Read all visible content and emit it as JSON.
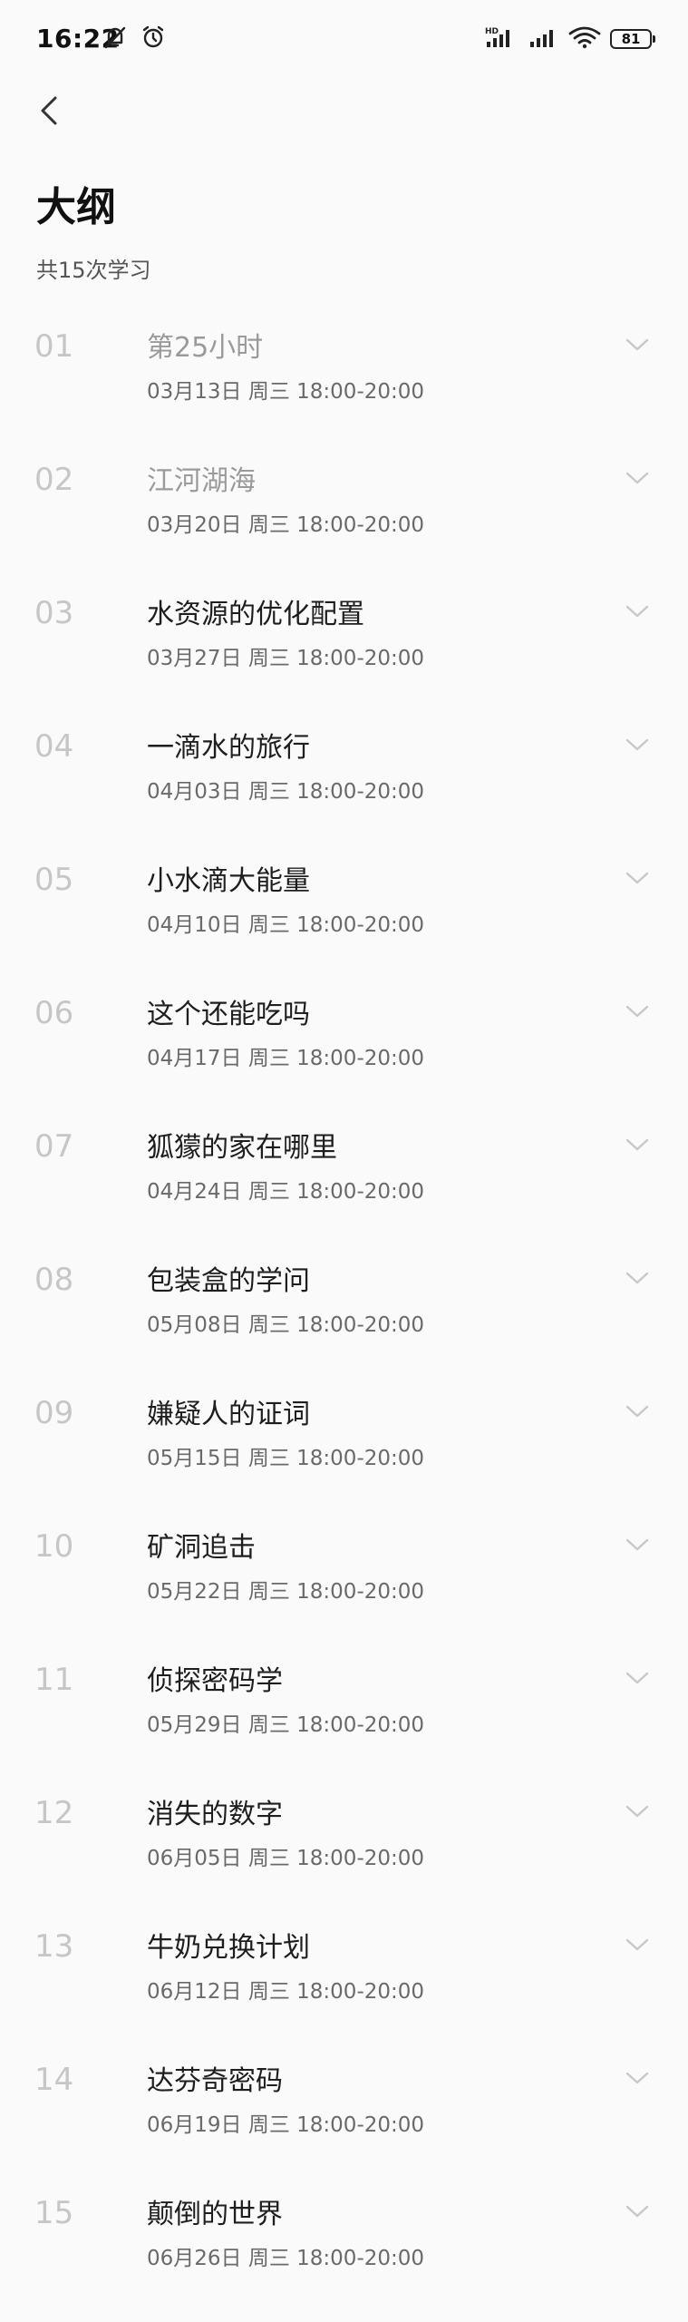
{
  "status_bar": {
    "time": "16:22",
    "battery": "81",
    "icons": [
      "notifications-muted-icon",
      "alarm-icon",
      "hd-signal-icon",
      "signal-icon",
      "wifi-icon",
      "battery-icon"
    ]
  },
  "header": {
    "back_icon": "chevron-left-icon",
    "title": "大纲",
    "subtitle": "共15次学习"
  },
  "lessons": [
    {
      "num": "01",
      "title": "第25小时",
      "time": "03月13日 周三 18:00-20:00"
    },
    {
      "num": "02",
      "title": "江河湖海",
      "time": "03月20日 周三 18:00-20:00"
    },
    {
      "num": "03",
      "title": "水资源的优化配置",
      "time": "03月27日 周三 18:00-20:00"
    },
    {
      "num": "04",
      "title": "一滴水的旅行",
      "time": "04月03日 周三 18:00-20:00"
    },
    {
      "num": "05",
      "title": "小水滴大能量",
      "time": "04月10日 周三 18:00-20:00"
    },
    {
      "num": "06",
      "title": "这个还能吃吗",
      "time": "04月17日 周三 18:00-20:00"
    },
    {
      "num": "07",
      "title": "狐獴的家在哪里",
      "time": "04月24日 周三 18:00-20:00"
    },
    {
      "num": "08",
      "title": "包装盒的学问",
      "time": "05月08日 周三 18:00-20:00"
    },
    {
      "num": "09",
      "title": "嫌疑人的证词",
      "time": "05月15日 周三 18:00-20:00"
    },
    {
      "num": "10",
      "title": "矿洞追击",
      "time": "05月22日 周三 18:00-20:00"
    },
    {
      "num": "11",
      "title": "侦探密码学",
      "time": "05月29日 周三 18:00-20:00"
    },
    {
      "num": "12",
      "title": "消失的数字",
      "time": "06月05日 周三 18:00-20:00"
    },
    {
      "num": "13",
      "title": "牛奶兑换计划",
      "time": "06月12日 周三 18:00-20:00"
    },
    {
      "num": "14",
      "title": "达芬奇密码",
      "time": "06月19日 周三 18:00-20:00"
    },
    {
      "num": "15",
      "title": "颠倒的世界",
      "time": "06月26日 周三 18:00-20:00"
    }
  ]
}
